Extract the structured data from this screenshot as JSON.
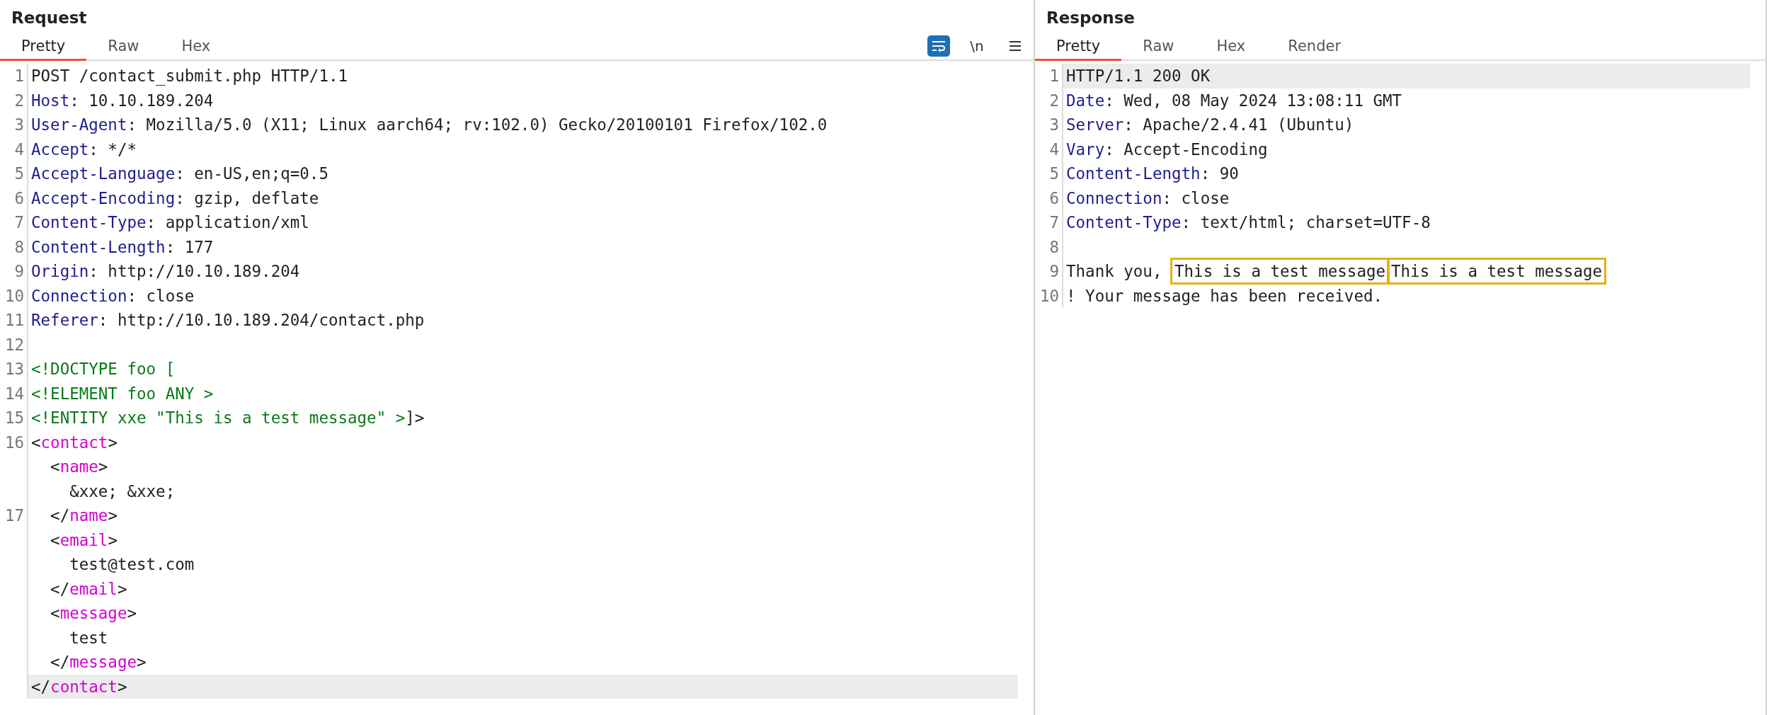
{
  "panels": [
    {
      "title": "Request",
      "tabs": [
        {
          "label": "Pretty",
          "selected": true
        },
        {
          "label": "Raw",
          "selected": false
        },
        {
          "label": "Hex",
          "selected": false
        }
      ],
      "toolbar": {
        "wrap_on": true,
        "newline_label": "\\n"
      },
      "lines": [
        {
          "number": "1",
          "selected": false,
          "parts": [
            {
              "kind": "plain",
              "text": "POST /contact_submit.php HTTP/1.1"
            }
          ]
        },
        {
          "number": "2",
          "selected": false,
          "parts": [
            {
              "kind": "key",
              "text": "Host"
            },
            {
              "kind": "plain",
              "text": ": 10.10.189.204"
            }
          ]
        },
        {
          "number": "3",
          "selected": false,
          "parts": [
            {
              "kind": "key",
              "text": "User-Agent"
            },
            {
              "kind": "plain",
              "text": ": Mozilla/5.0 (X11; Linux aarch64; rv:102.0) Gecko/20100101 Firefox/102.0"
            }
          ]
        },
        {
          "number": "4",
          "selected": false,
          "parts": [
            {
              "kind": "key",
              "text": "Accept"
            },
            {
              "kind": "plain",
              "text": ": */*"
            }
          ]
        },
        {
          "number": "5",
          "selected": false,
          "parts": [
            {
              "kind": "key",
              "text": "Accept-Language"
            },
            {
              "kind": "plain",
              "text": ": en-US,en;q=0.5"
            }
          ]
        },
        {
          "number": "6",
          "selected": false,
          "parts": [
            {
              "kind": "key",
              "text": "Accept-Encoding"
            },
            {
              "kind": "plain",
              "text": ": gzip, deflate"
            }
          ]
        },
        {
          "number": "7",
          "selected": false,
          "parts": [
            {
              "kind": "key",
              "text": "Content-Type"
            },
            {
              "kind": "plain",
              "text": ": application/xml"
            }
          ]
        },
        {
          "number": "8",
          "selected": false,
          "parts": [
            {
              "kind": "key",
              "text": "Content-Length"
            },
            {
              "kind": "plain",
              "text": ": 177"
            }
          ]
        },
        {
          "number": "9",
          "selected": false,
          "parts": [
            {
              "kind": "key",
              "text": "Origin"
            },
            {
              "kind": "plain",
              "text": ": http://10.10.189.204"
            }
          ]
        },
        {
          "number": "10",
          "selected": false,
          "parts": [
            {
              "kind": "key",
              "text": "Connection"
            },
            {
              "kind": "plain",
              "text": ": close"
            }
          ]
        },
        {
          "number": "11",
          "selected": false,
          "parts": [
            {
              "kind": "key",
              "text": "Referer"
            },
            {
              "kind": "plain",
              "text": ": http://10.10.189.204/contact.php"
            }
          ]
        },
        {
          "number": "12",
          "selected": false
        },
        {
          "number": "13",
          "selected": false,
          "parts": [
            {
              "kind": "dtd",
              "text": "<!DOCTYPE foo ["
            }
          ]
        },
        {
          "number": "14",
          "selected": false,
          "parts": [
            {
              "kind": "dtd",
              "text": "<!ELEMENT foo ANY >"
            }
          ]
        },
        {
          "number": "15",
          "selected": false,
          "parts": [
            {
              "kind": "dtd",
              "text": "<!ENTITY xxe \"This is a test message\" >"
            },
            {
              "kind": "plain",
              "text": "]>"
            }
          ]
        },
        {
          "number": "16",
          "selected": false,
          "parts": [
            {
              "kind": "plain",
              "text": "<"
            },
            {
              "kind": "tag",
              "text": "contact"
            },
            {
              "kind": "plain",
              "text": ">"
            }
          ]
        },
        {
          "selected": false,
          "parts": [
            {
              "kind": "plain",
              "text": "  <"
            },
            {
              "kind": "tag",
              "text": "name"
            },
            {
              "kind": "plain",
              "text": ">"
            }
          ]
        },
        {
          "selected": false,
          "parts": [
            {
              "kind": "plain",
              "text": "    &xxe; &xxe;"
            }
          ]
        },
        {
          "number": "17",
          "selected": false,
          "parts": [
            {
              "kind": "plain",
              "text": "  </"
            },
            {
              "kind": "tag",
              "text": "name"
            },
            {
              "kind": "plain",
              "text": ">"
            }
          ]
        },
        {
          "selected": false,
          "parts": [
            {
              "kind": "plain",
              "text": "  <"
            },
            {
              "kind": "tag",
              "text": "email"
            },
            {
              "kind": "plain",
              "text": ">"
            }
          ]
        },
        {
          "selected": false,
          "parts": [
            {
              "kind": "plain",
              "text": "    test@test.com"
            }
          ]
        },
        {
          "selected": false,
          "parts": [
            {
              "kind": "plain",
              "text": "  </"
            },
            {
              "kind": "tag",
              "text": "email"
            },
            {
              "kind": "plain",
              "text": ">"
            }
          ]
        },
        {
          "selected": false,
          "parts": [
            {
              "kind": "plain",
              "text": "  <"
            },
            {
              "kind": "tag",
              "text": "message"
            },
            {
              "kind": "plain",
              "text": ">"
            }
          ]
        },
        {
          "selected": false,
          "parts": [
            {
              "kind": "plain",
              "text": "    test"
            }
          ]
        },
        {
          "selected": false,
          "parts": [
            {
              "kind": "plain",
              "text": "  </"
            },
            {
              "kind": "tag",
              "text": "message"
            },
            {
              "kind": "plain",
              "text": ">"
            }
          ]
        },
        {
          "selected": true,
          "parts": [
            {
              "kind": "plain",
              "text": "</"
            },
            {
              "kind": "tag",
              "text": "contact"
            },
            {
              "kind": "plain",
              "text": ">"
            }
          ]
        }
      ]
    },
    {
      "title": "Response",
      "tabs": [
        {
          "label": "Pretty",
          "selected": true
        },
        {
          "label": "Raw",
          "selected": false
        },
        {
          "label": "Hex",
          "selected": false
        },
        {
          "label": "Render",
          "selected": false
        }
      ],
      "lines": [
        {
          "number": "1",
          "selected": true,
          "parts": [
            {
              "kind": "plain",
              "text": "HTTP/1.1 200 OK"
            }
          ]
        },
        {
          "number": "2",
          "selected": false,
          "parts": [
            {
              "kind": "key",
              "text": "Date"
            },
            {
              "kind": "plain",
              "text": ": Wed, 08 May 2024 13:08:11 GMT"
            }
          ]
        },
        {
          "number": "3",
          "selected": false,
          "parts": [
            {
              "kind": "key",
              "text": "Server"
            },
            {
              "kind": "plain",
              "text": ": Apache/2.4.41 (Ubuntu)"
            }
          ]
        },
        {
          "number": "4",
          "selected": false,
          "parts": [
            {
              "kind": "key",
              "text": "Vary"
            },
            {
              "kind": "plain",
              "text": ": Accept-Encoding"
            }
          ]
        },
        {
          "number": "5",
          "selected": false,
          "parts": [
            {
              "kind": "key",
              "text": "Content-Length"
            },
            {
              "kind": "plain",
              "text": ": 90"
            }
          ]
        },
        {
          "number": "6",
          "selected": false,
          "parts": [
            {
              "kind": "key",
              "text": "Connection"
            },
            {
              "kind": "plain",
              "text": ": close"
            }
          ]
        },
        {
          "number": "7",
          "selected": false,
          "parts": [
            {
              "kind": "key",
              "text": "Content-Type"
            },
            {
              "kind": "plain",
              "text": ": text/html; charset=UTF-8"
            }
          ]
        },
        {
          "number": "8",
          "selected": false
        },
        {
          "number": "9",
          "selected": false,
          "parts": [
            {
              "kind": "plain",
              "text": "Thank you, "
            },
            {
              "kind": "boxed",
              "text": "This is a test message"
            },
            {
              "kind": "boxed",
              "text": "This is a test message"
            }
          ]
        },
        {
          "number": "10",
          "selected": false,
          "parts": [
            {
              "kind": "plain",
              "text": "! Your message has been received."
            }
          ]
        }
      ]
    }
  ]
}
